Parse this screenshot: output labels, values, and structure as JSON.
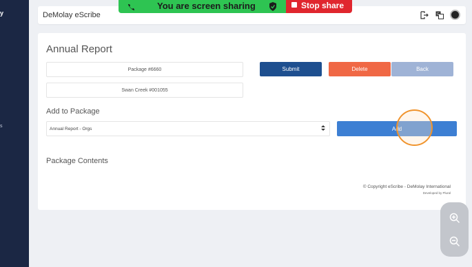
{
  "sidebar": {
    "top_glyph": "y",
    "mid_glyph": "s"
  },
  "topbar": {
    "app_title": "DeMolay eScribe"
  },
  "share_bar": {
    "message": "You are screen sharing",
    "stop_label": "Stop share"
  },
  "main": {
    "title": "Annual Report",
    "package_field": "Package #6660",
    "chapter_field": "Swan Creek #001055",
    "buttons": {
      "submit": "Submit",
      "delete": "Delete",
      "back": "Back"
    },
    "add_to_package_label": "Add to Package",
    "select_value": "Annual Report - Orgs",
    "add_button": "Add",
    "package_contents_label": "Package Contents",
    "copyright": "© Copyright eScribe - DeMolay International",
    "developed_by": "Developed by Plural"
  },
  "colors": {
    "sidebar": "#1b2744",
    "submit": "#1e4f8f",
    "delete": "#f06845",
    "back": "#9fb3d6",
    "add": "#3d7fd3",
    "share_green": "#2ec452",
    "share_red": "#e0262e",
    "click_ring": "#f0932b"
  },
  "icons": [
    "phone-icon",
    "shield-check-icon",
    "stop-square-icon",
    "logout-icon",
    "translate-icon",
    "avatar",
    "zoom-in-icon",
    "zoom-out-icon",
    "select-caret-icon"
  ]
}
